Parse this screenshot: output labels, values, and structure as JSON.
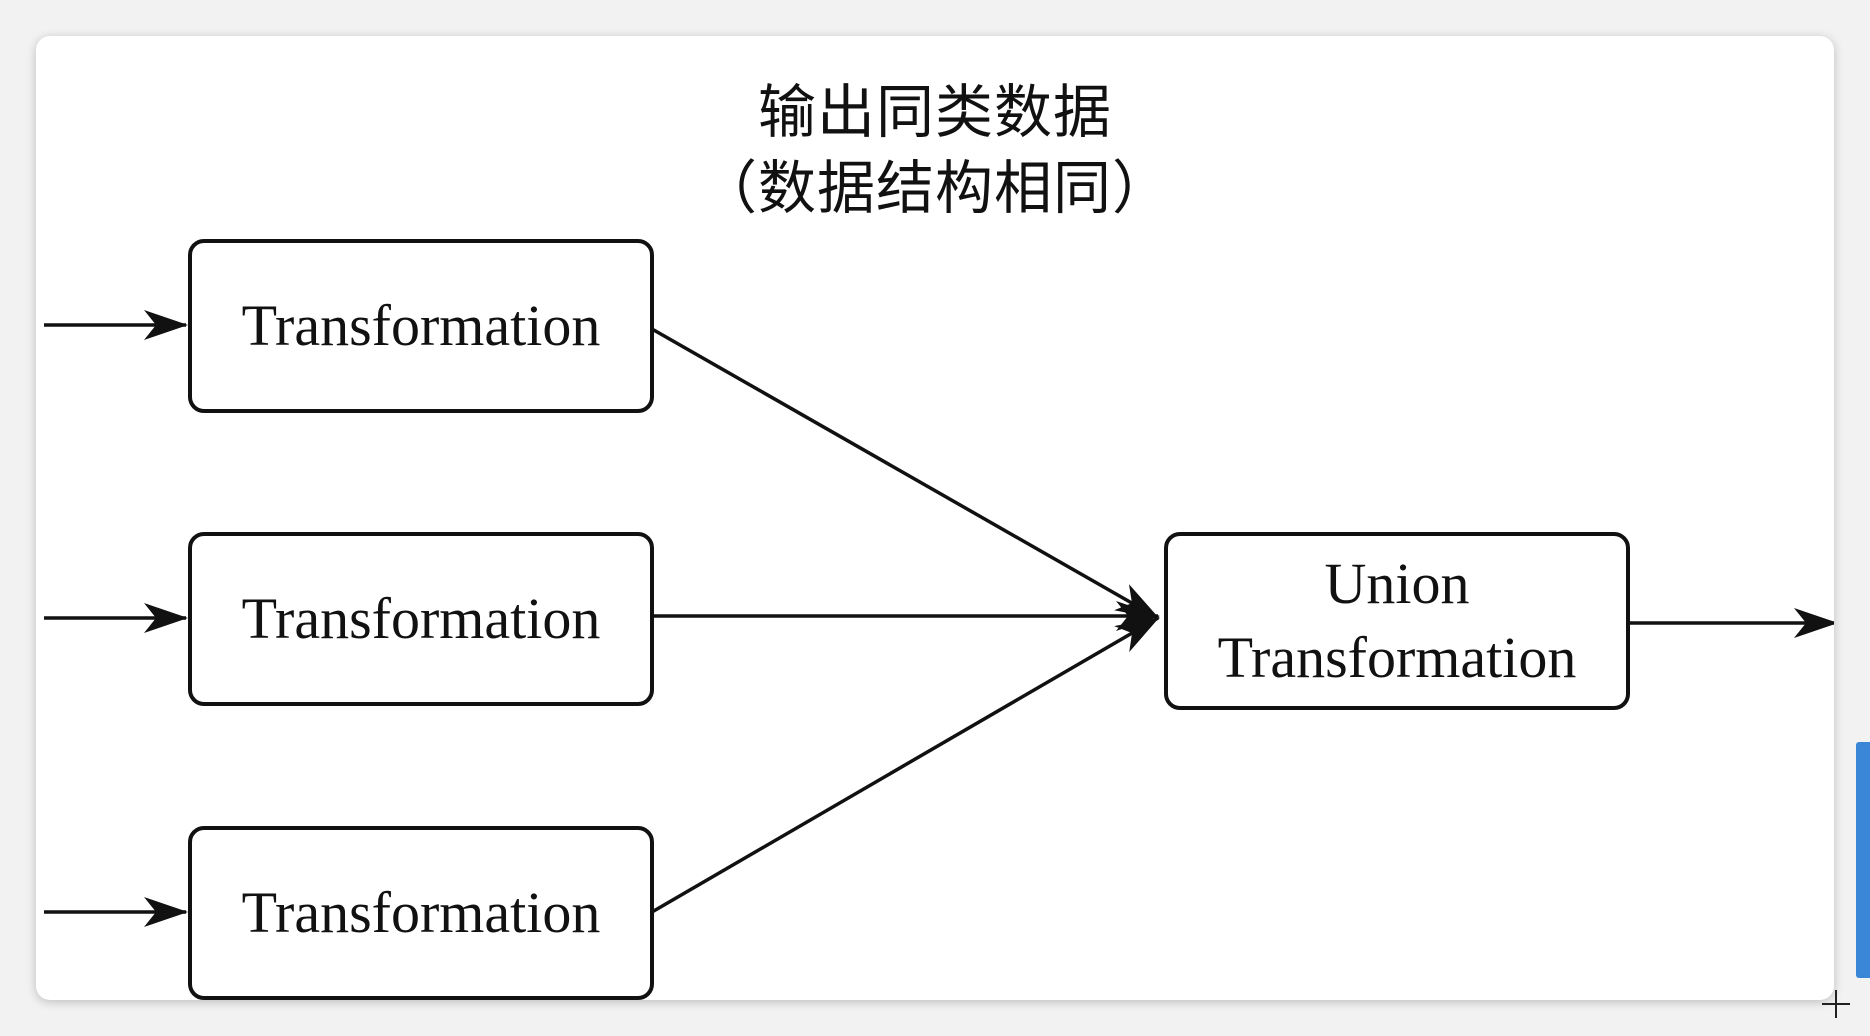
{
  "title": {
    "line1": "输出同类数据",
    "line2": "（数据结构相同）"
  },
  "nodes": {
    "transformation_1": "Transformation",
    "transformation_2": "Transformation",
    "transformation_3": "Transformation",
    "union_line1": "Union",
    "union_line2": "Transformation"
  },
  "colors": {
    "stroke": "#111111",
    "background": "#ffffff",
    "scrollbar": "#3a87d8"
  }
}
